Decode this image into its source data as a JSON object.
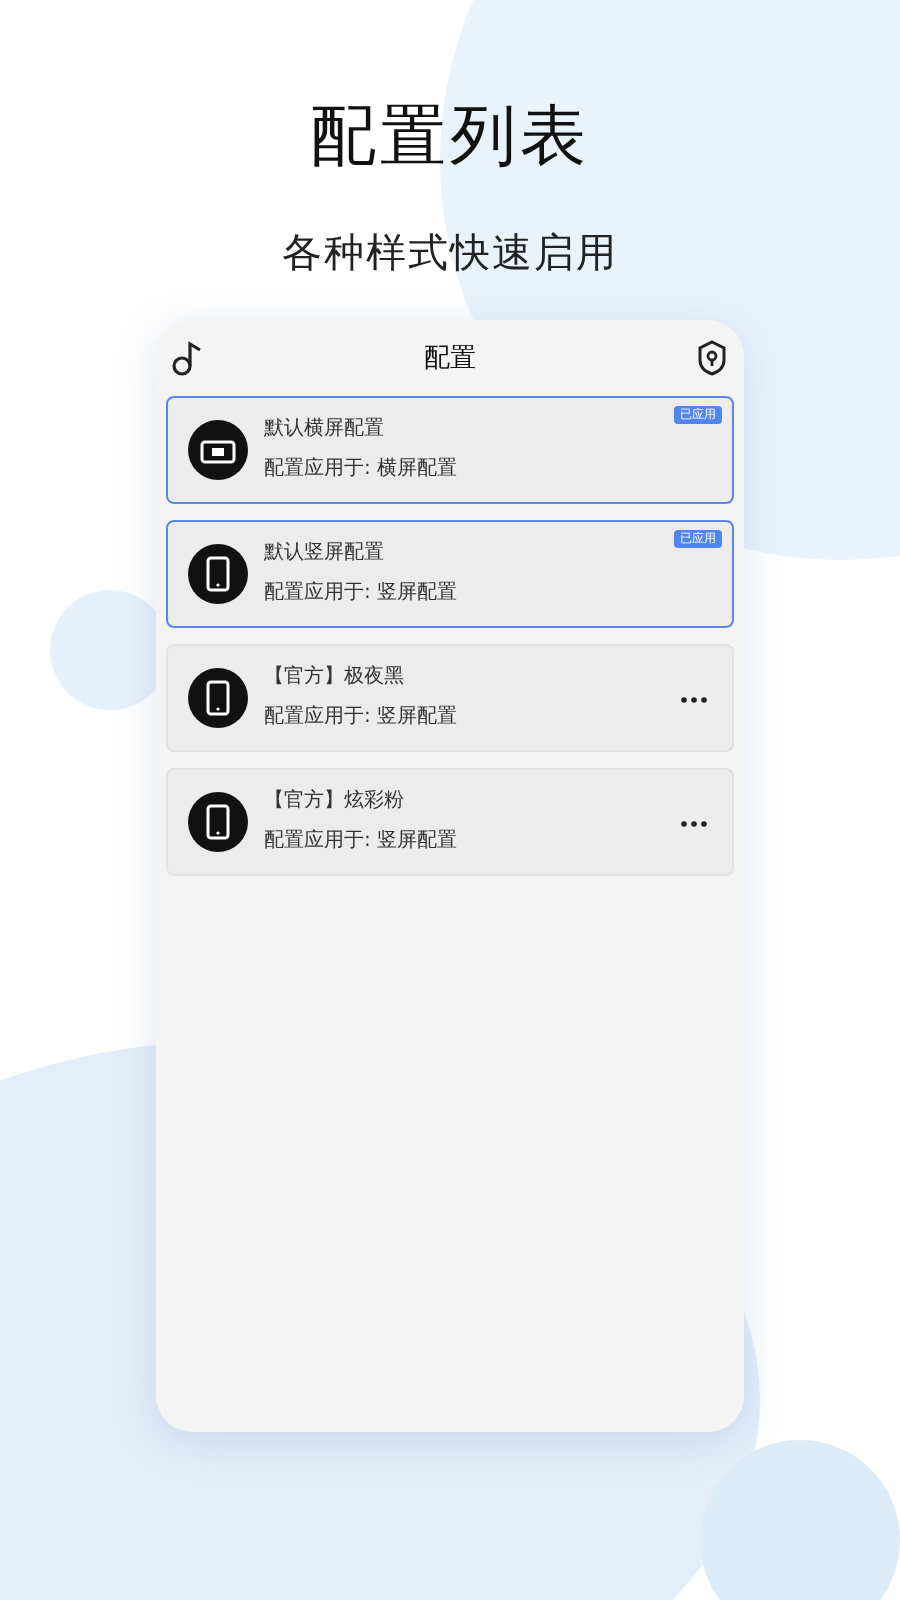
{
  "title": "配置列表",
  "subtitle": "各种样式快速启用",
  "phone": {
    "header_title": "配置",
    "configs": [
      {
        "name": "默认横屏配置",
        "applies_to": "配置应用于: 横屏配置",
        "kind": "landscape",
        "selected": true,
        "badge": "已应用"
      },
      {
        "name": "默认竖屏配置",
        "applies_to": "配置应用于: 竖屏配置",
        "kind": "portrait",
        "selected": true,
        "badge": "已应用"
      },
      {
        "name": "【官方】极夜黑",
        "applies_to": "配置应用于: 竖屏配置",
        "kind": "portrait",
        "selected": false
      },
      {
        "name": "【官方】炫彩粉",
        "applies_to": "配置应用于: 竖屏配置",
        "kind": "portrait",
        "selected": false
      }
    ]
  }
}
